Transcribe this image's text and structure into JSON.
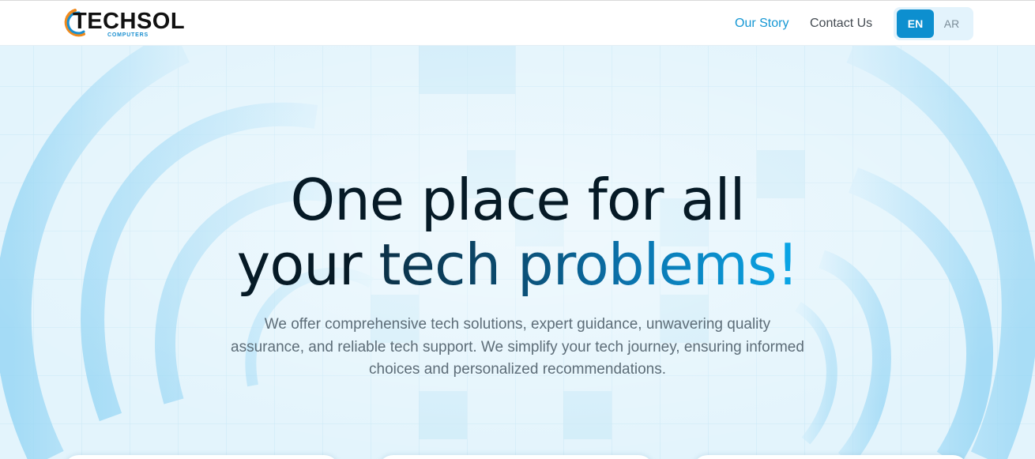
{
  "brand": {
    "name": "TECHSOL",
    "tagline": "COMPUTERS",
    "colors": {
      "accent": "#1597d4",
      "orange": "#f08a1c",
      "dark": "#061a26"
    }
  },
  "nav": {
    "links": [
      {
        "label": "Our Story",
        "active": true
      },
      {
        "label": "Contact Us",
        "active": false
      }
    ],
    "languages": [
      {
        "label": "EN",
        "selected": true
      },
      {
        "label": "AR",
        "selected": false
      }
    ]
  },
  "hero": {
    "title_line1": "One place for all",
    "title_line2_plain": "your ",
    "title_line2_highlight": "tech problems!",
    "description": "We offer comprehensive tech solutions, expert guidance, unwavering quality assurance, and reliable tech support. We simplify your tech journey, ensuring informed choices and personalized recommendations."
  }
}
